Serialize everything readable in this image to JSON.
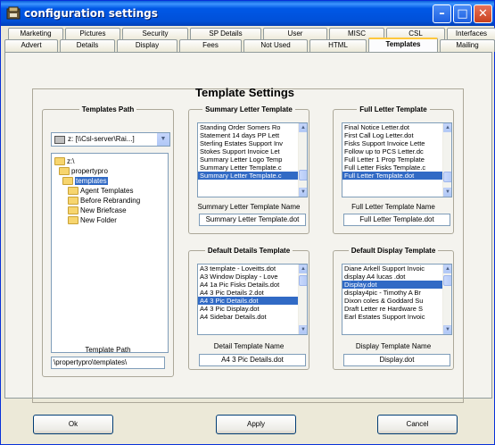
{
  "window": {
    "title": "configuration settings"
  },
  "tabs": {
    "top": [
      "Marketing",
      "Pictures",
      "Security",
      "SP Details",
      "User",
      "MISC",
      "CSL",
      "Interfaces"
    ],
    "bottom": [
      "Advert",
      "Details",
      "Display",
      "Fees",
      "Not Used",
      "HTML",
      "Templates",
      "Mailing"
    ],
    "active": "Templates"
  },
  "heading": "Template Settings",
  "templates_path": {
    "title": "Templates Path",
    "drive": "z: [\\\\Csl-server\\Rai...]",
    "tree": [
      "z:\\",
      "propertypro",
      "templates",
      "Agent Templates",
      "Before Rebranding",
      "New Briefcase",
      "New Folder"
    ],
    "selected": "templates",
    "path_label": "Template Path",
    "path_value": "\\propertypro\\templates\\"
  },
  "summary": {
    "title": "Summary Letter Template",
    "items": [
      "Standing Order Somers Ro",
      "Statement 14 days PP Lett",
      "Sterling Estates Support Inv",
      "Stokes Support Invoice Let",
      "Summary Letter Logo Temp",
      "Summary Letter Template.c",
      "Summary Letter Template.c"
    ],
    "selected_index": 6,
    "name_label": "Summary Letter Template Name",
    "name_value": "Summary Letter Template.dot"
  },
  "full": {
    "title": "Full Letter Template",
    "items": [
      "Final Notice Letter.dot",
      "First Call Log Letter.dot",
      "Fisks Support Invoice Lette",
      "Follow up to PCS Letter.dc",
      "Full Letter 1 Prop Template",
      "Full Letter Fisks Template.c",
      "Full Letter Template.dot"
    ],
    "selected_index": 6,
    "name_label": "Full Letter Template Name",
    "name_value": "Full Letter Template.dot"
  },
  "details": {
    "title": "Default Details Template",
    "items": [
      "A3 template - Loveitts.dot",
      "A3 Window Display - Love",
      "A4 1a Pic Fisks Details.dot",
      "A4 3 Pic Details 2.dot",
      "A4 3 Pic Details.dot",
      "A4 3 Pic Display.dot",
      "A4 Sidebar Details.dot"
    ],
    "selected_index": 4,
    "name_label": "Detail Template Name",
    "name_value": "A4 3 Pic Details.dot"
  },
  "display": {
    "title": "Default Display Template",
    "items": [
      "Diane Arkell Support Invoic",
      "display A4 lucas .dot",
      "Display.dot",
      "display4pic - Timothy A Br",
      "Dixon coles & Goddard Su",
      "Draft Letter re Hardware S",
      "Earl Estates Support Invoic"
    ],
    "selected_index": 2,
    "name_label": "Display Template Name",
    "name_value": "Display.dot"
  },
  "buttons": {
    "ok": "Ok",
    "apply": "Apply",
    "cancel": "Cancel"
  }
}
